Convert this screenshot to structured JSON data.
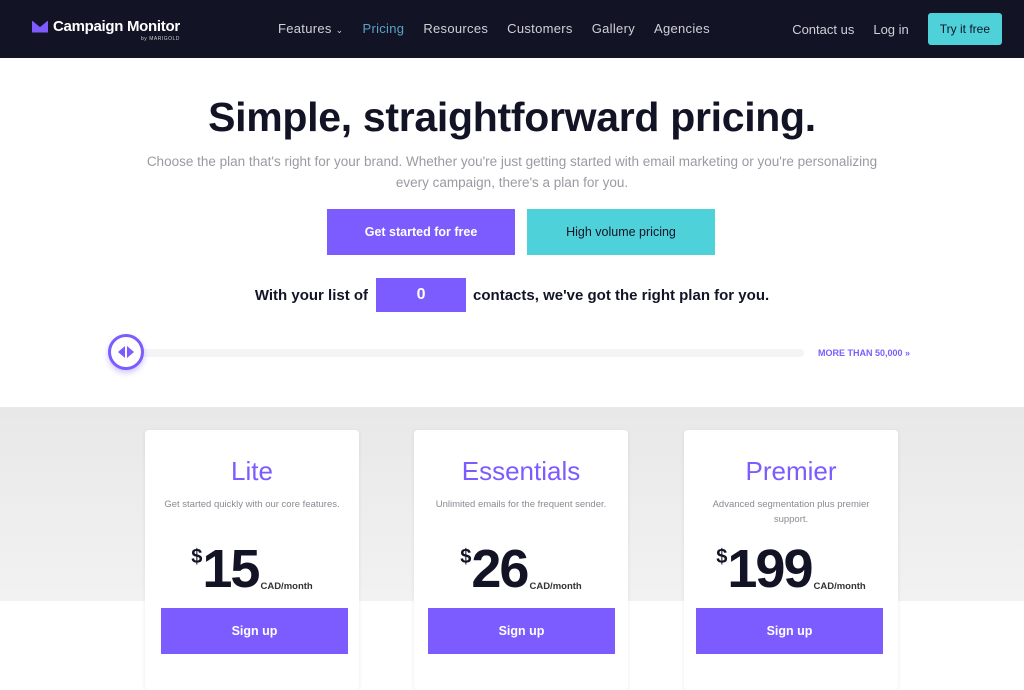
{
  "nav": {
    "brand": "Campaign Monitor",
    "brand_sub": "by MARIGOLD",
    "items": [
      "Features",
      "Pricing",
      "Resources",
      "Customers",
      "Gallery",
      "Agencies"
    ],
    "active": "Pricing",
    "contact": "Contact us",
    "login": "Log in",
    "try": "Try it free"
  },
  "hero": {
    "title": "Simple, straightforward pricing.",
    "subtitle": "Choose the plan that's right for your brand. Whether you're just getting started with email marketing or you're personalizing every campaign, there's a plan for you.",
    "cta_primary": "Get started for free",
    "cta_secondary": "High volume pricing"
  },
  "slider": {
    "prefix": "With your list of",
    "value": "0",
    "suffix": "contacts, we've got the right plan for you.",
    "max_link": "MORE THAN 50,000 »",
    "position": 0
  },
  "plans": [
    {
      "name": "Lite",
      "desc": "Get started quickly with our core features.",
      "currency": "$",
      "price": "15",
      "period": "CAD/month",
      "cta": "Sign up"
    },
    {
      "name": "Essentials",
      "desc": "Unlimited emails for the frequent sender.",
      "currency": "$",
      "price": "26",
      "period": "CAD/month",
      "cta": "Sign up"
    },
    {
      "name": "Premier",
      "desc": "Advanced segmentation plus premier support.",
      "currency": "$",
      "price": "199",
      "period": "CAD/month",
      "cta": "Sign up"
    }
  ],
  "colors": {
    "accent": "#7c5cff",
    "teal": "#4fd1d9",
    "nav_bg": "#121426"
  }
}
